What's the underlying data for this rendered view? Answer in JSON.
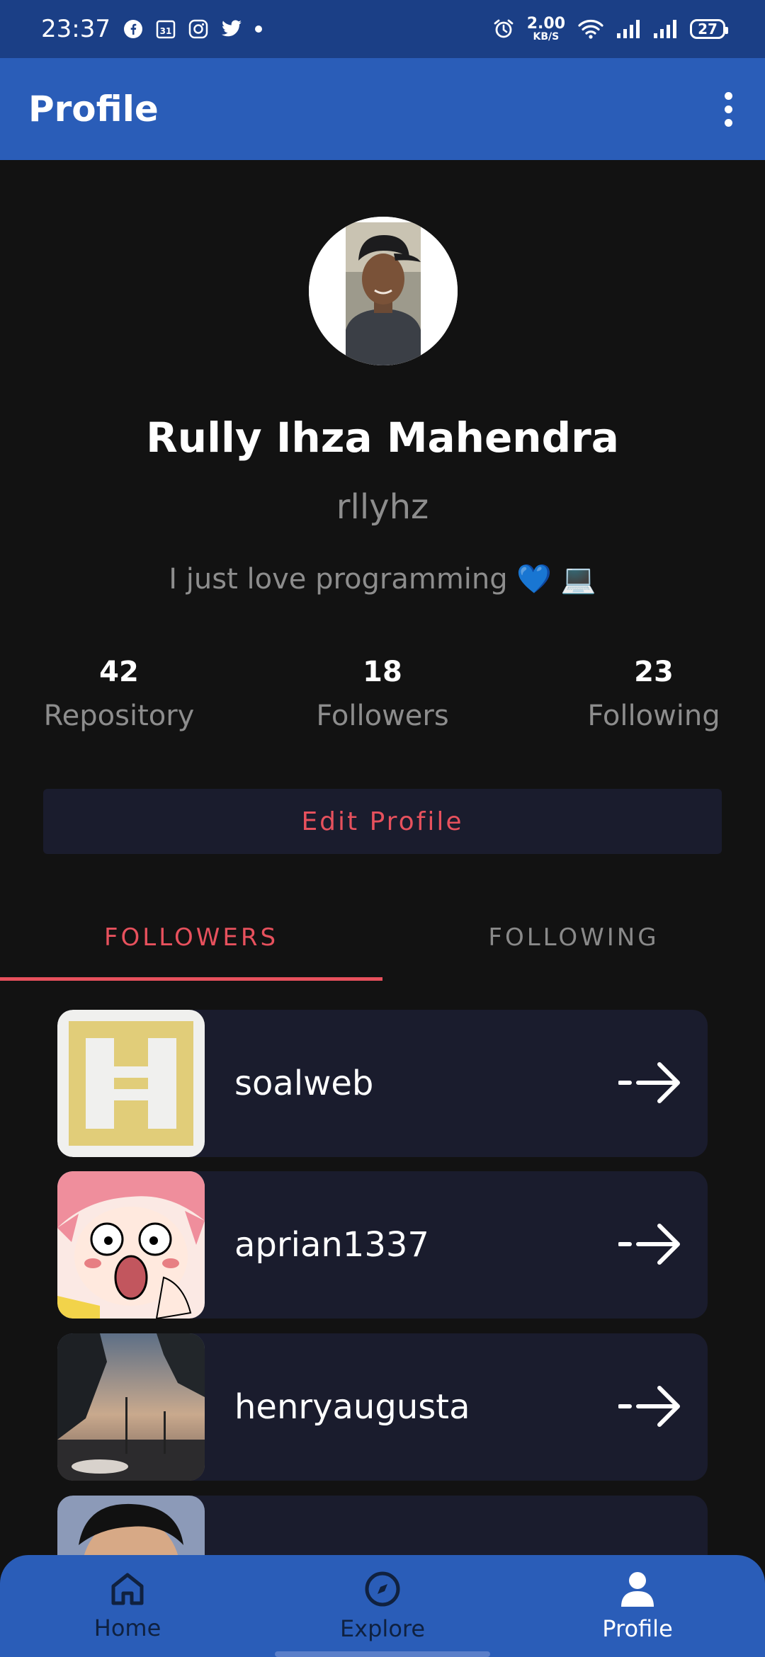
{
  "status_bar": {
    "time": "23:37",
    "speed_value": "2.00",
    "speed_unit": "KB/S",
    "battery": "27",
    "icons": [
      "facebook-icon",
      "calendar-icon",
      "instagram-icon",
      "twitter-icon",
      "alarm-icon",
      "wifi-icon",
      "signal-icon",
      "signal-icon",
      "battery-icon"
    ]
  },
  "app_bar": {
    "title": "Profile",
    "menu_icon": "more-vert-icon"
  },
  "profile": {
    "name": "Rully Ihza Mahendra",
    "username": "rllyhz",
    "bio": "I just love programming 💙 💻",
    "stats": [
      {
        "value": "42",
        "label": "Repository"
      },
      {
        "value": "18",
        "label": "Followers"
      },
      {
        "value": "23",
        "label": "Following"
      }
    ],
    "edit_button": "Edit Profile"
  },
  "tabs": [
    {
      "label": "FOLLOWERS",
      "active": true
    },
    {
      "label": "FOLLOWING",
      "active": false
    }
  ],
  "followers": [
    {
      "username": "soalweb"
    },
    {
      "username": "aprian1337"
    },
    {
      "username": "henryaugusta"
    },
    {
      "username": ""
    }
  ],
  "bottom_nav": [
    {
      "label": "Home",
      "icon": "home-icon",
      "active": false
    },
    {
      "label": "Explore",
      "icon": "compass-icon",
      "active": false
    },
    {
      "label": "Profile",
      "icon": "person-icon",
      "active": true
    }
  ],
  "colors": {
    "status_bar": "#1b3f86",
    "primary": "#2a5db8",
    "background": "#121212",
    "card": "#1a1c2d",
    "accent": "#e7515d",
    "muted_text": "#8d8d8d"
  }
}
